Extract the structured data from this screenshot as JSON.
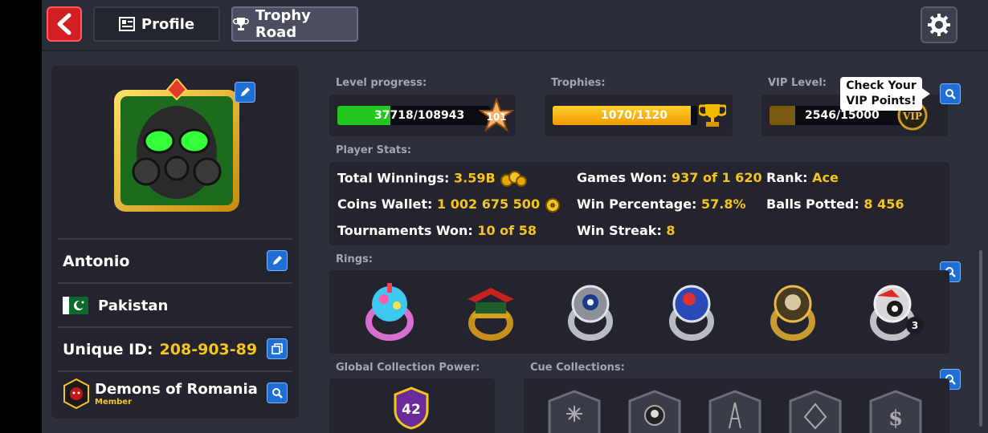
{
  "tabs": {
    "profile": "Profile",
    "trophy_road": "Trophy Road"
  },
  "player": {
    "name": "Antonio",
    "country": "Pakistan",
    "unique_id_label": "Unique ID:",
    "unique_id": "208-903-89",
    "club_name": "Demons of Romania",
    "club_role": "Member"
  },
  "level": {
    "label": "Level progress:",
    "text": "37718/108943",
    "value": 37718,
    "max": 108943,
    "badge": "101"
  },
  "trophies": {
    "label": "Trophies:",
    "text": "1070/1120",
    "value": 1070,
    "max": 1120
  },
  "vip": {
    "label": "VIP Level:",
    "text": "2546/15000",
    "value": 2546,
    "max": 15000,
    "badge": "VIP",
    "tooltip_line1": "Check Your",
    "tooltip_line2": "VIP Points!"
  },
  "stats": {
    "section_label": "Player Stats:",
    "total_winnings_label": "Total Winnings:",
    "total_winnings": "3.59B",
    "coins_wallet_label": "Coins Wallet:",
    "coins_wallet": "1 002 675 500",
    "tournaments_won_label": "Tournaments Won:",
    "tournaments_won": "10 of 58",
    "games_won_label": "Games Won:",
    "games_won": "937 of 1 620",
    "win_percentage_label": "Win Percentage:",
    "win_percentage": "57.8%",
    "win_streak_label": "Win Streak:",
    "win_streak": "8",
    "rank_label": "Rank:",
    "rank": "Ace",
    "balls_potted_label": "Balls Potted:",
    "balls_potted": "8 456"
  },
  "rings": {
    "section_label": "Rings:",
    "count_badge": "3"
  },
  "collection": {
    "gcp_label": "Global Collection Power:",
    "gcp_value": "42",
    "cue_label": "Cue Collections:"
  },
  "colors": {
    "accent_yellow": "#f5c51f",
    "blue_button": "#1f6fd6",
    "back_red": "#d21f24",
    "level_green": "#22c81e",
    "trophy_orange": "#f5a800"
  }
}
